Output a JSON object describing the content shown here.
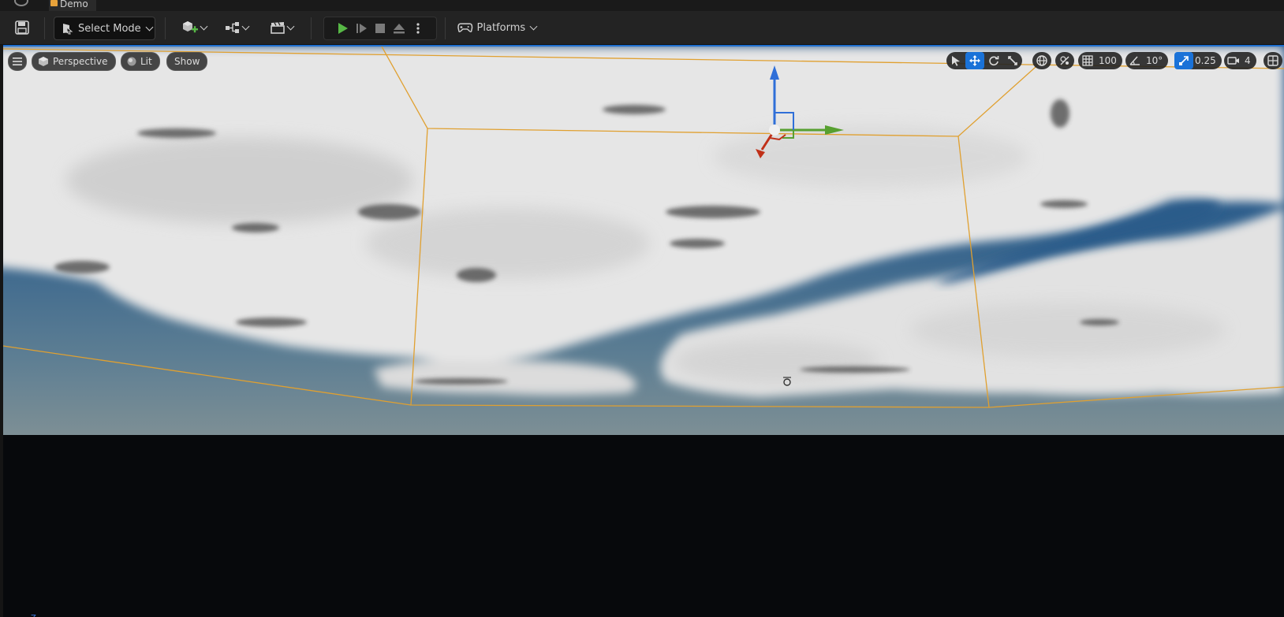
{
  "window": {
    "doc_tab": "Demo"
  },
  "toolbar": {
    "save_icon": "save-icon",
    "select_mode_label": "Select Mode",
    "platforms_label": "Platforms"
  },
  "viewport": {
    "perspective_label": "Perspective",
    "lit_label": "Lit",
    "show_label": "Show",
    "grid_snap_value": "100",
    "rotation_snap_value": "10°",
    "scale_snap_value": "0.25",
    "camera_speed_value": "4",
    "axis_z": "Z",
    "axis_y": "Y",
    "axis_x": "X"
  },
  "colors": {
    "accent": "#1a72d8",
    "play_green": "#57b846",
    "bounds_orange": "#e0a030"
  }
}
